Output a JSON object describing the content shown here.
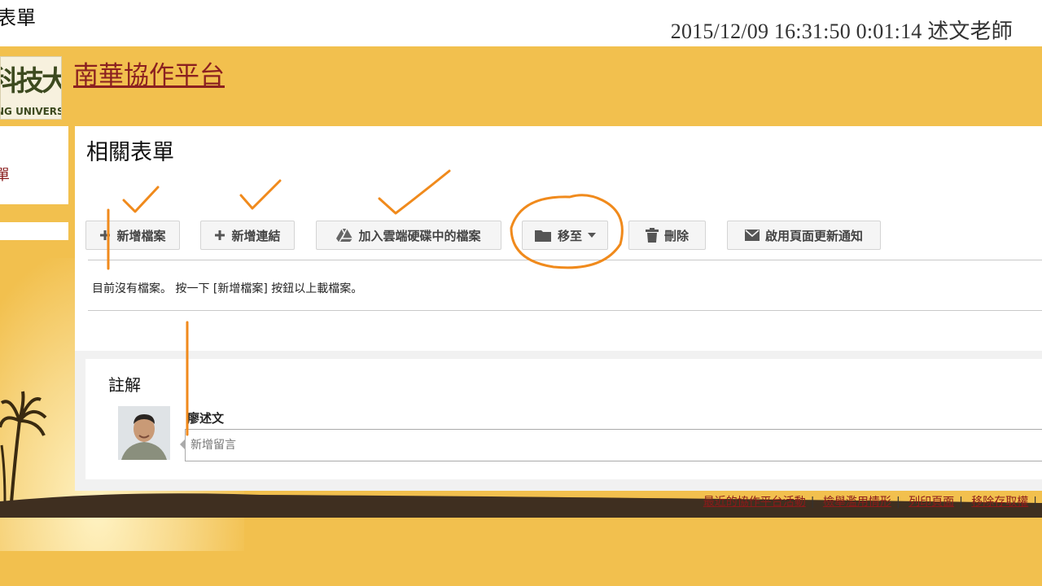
{
  "page_label": "表單",
  "recording_stamp": "2015/12/09 16:31:50 0:01:14 述文老師",
  "header": {
    "logo_chars": "科技大學",
    "logo_en": "NG UNIVERSITY",
    "site_title": "南華協作平台"
  },
  "sidebar": {
    "item_mark": "單"
  },
  "main": {
    "title": "相關表單",
    "toolbar": [
      {
        "label": "新增檔案",
        "icon": "plus-icon"
      },
      {
        "label": "新增連結",
        "icon": "plus-icon"
      },
      {
        "label": "加入雲端硬碟中的檔案",
        "icon": "google-drive-icon"
      },
      {
        "label": "移至",
        "icon": "folder-icon"
      },
      {
        "label": "刪除",
        "icon": "trash-icon"
      },
      {
        "label": "啟用頁面更新通知",
        "icon": "envelope-icon"
      }
    ],
    "empty_message": "目前沒有檔案。 按一下 [新增檔案] 按鈕以上載檔案。"
  },
  "comments": {
    "title": "註解",
    "commenter": "廖述文",
    "input_placeholder": "新增留言"
  },
  "footer": {
    "links": [
      "最近的協作平台活動",
      "檢舉濫用情形",
      "列印頁面",
      "移除存取權"
    ]
  },
  "colors": {
    "site_background": "#f2c04e",
    "title_link": "#8b2020",
    "annotation": "#f08a1c"
  }
}
